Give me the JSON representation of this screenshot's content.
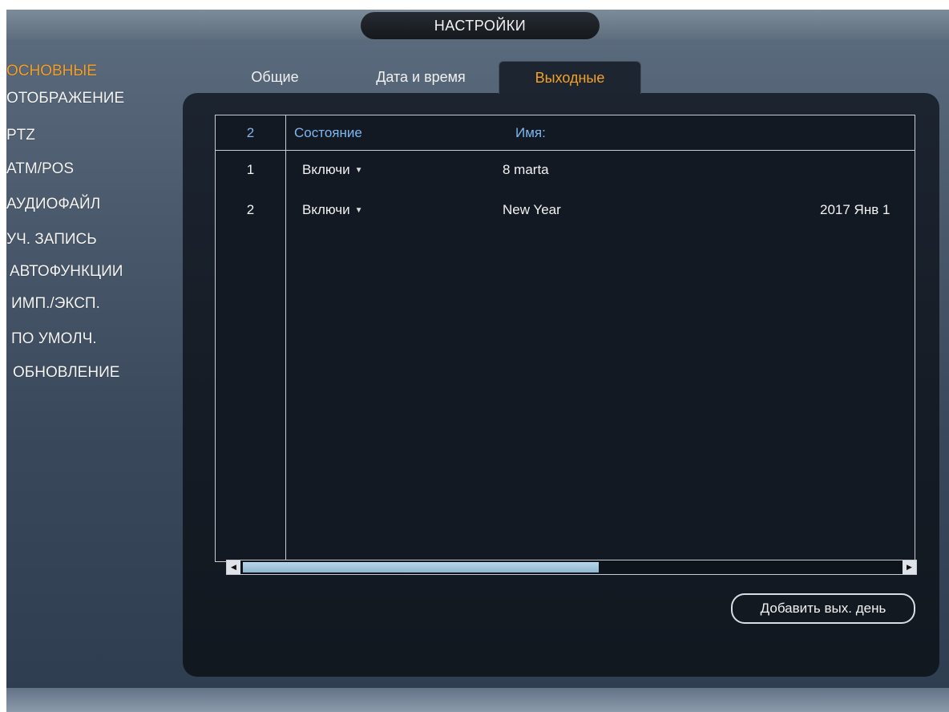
{
  "title": "НАСТРОЙКИ",
  "sidebar": {
    "items": [
      {
        "label": "ОСНОВНЫЕ",
        "active": true
      },
      {
        "label": "ОТОБРАЖЕНИЕ",
        "active": false
      },
      {
        "label": "PTZ",
        "active": false
      },
      {
        "label": "ATM/POS",
        "active": false
      },
      {
        "label": "АУДИОФАЙЛ",
        "active": false
      },
      {
        "label": "УЧ. ЗАПИСЬ",
        "active": false
      },
      {
        "label": "АВТОФУНКЦИИ",
        "active": false
      },
      {
        "label": "ИМП./ЭКСП.",
        "active": false
      },
      {
        "label": "ПО УМОЛЧ.",
        "active": false
      },
      {
        "label": "ОБНОВЛЕНИЕ",
        "active": false
      }
    ]
  },
  "tabs": [
    {
      "label": "Общие",
      "active": false
    },
    {
      "label": "Дата и время",
      "active": false
    },
    {
      "label": "Выходные",
      "active": true
    }
  ],
  "table": {
    "count": "2",
    "headers": {
      "status": "Состояние",
      "name": "Имя:"
    },
    "rows": [
      {
        "num": "1",
        "status": "Включи",
        "name": "8 marta",
        "date": ""
      },
      {
        "num": "2",
        "status": "Включи",
        "name": "New Year",
        "date": "2017 Янв 1"
      }
    ]
  },
  "icons": {
    "select_arrow": "caret-down-icon",
    "scroll_left": "arrow-left-icon",
    "scroll_right": "arrow-right-icon"
  },
  "add_button": "Добавить вых. день",
  "colors": {
    "active_accent": "#f4a12a",
    "header_text": "#7fb6f0",
    "panel_bg": "#151b24"
  }
}
